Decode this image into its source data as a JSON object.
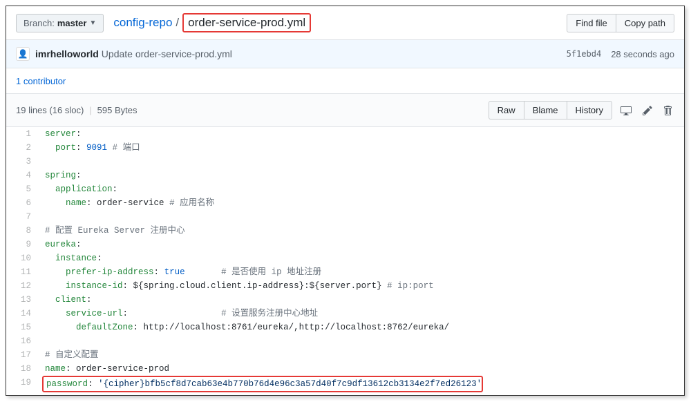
{
  "branch": {
    "label": "Branch:",
    "name": "master"
  },
  "breadcrumb": {
    "repo": "config-repo",
    "sep": "/",
    "file": "order-service-prod.yml"
  },
  "header_buttons": {
    "find": "Find file",
    "copy": "Copy path"
  },
  "commit": {
    "author": "imrhelloworld",
    "message": "Update order-service-prod.yml",
    "sha": "5f1ebd4",
    "time": "28 seconds ago"
  },
  "contributors": "1 contributor",
  "file_info": {
    "lines": "19 lines (16 sloc)",
    "size": "595 Bytes"
  },
  "file_actions": {
    "raw": "Raw",
    "blame": "Blame",
    "history": "History"
  },
  "code": [
    {
      "n": 1,
      "segs": [
        {
          "t": "server",
          "c": "hl-key"
        },
        {
          "t": ":",
          "c": ""
        }
      ]
    },
    {
      "n": 2,
      "segs": [
        {
          "t": "  ",
          "c": ""
        },
        {
          "t": "port",
          "c": "hl-key"
        },
        {
          "t": ": ",
          "c": ""
        },
        {
          "t": "9091",
          "c": "hl-num"
        },
        {
          "t": " ",
          "c": ""
        },
        {
          "t": "# 端口",
          "c": "hl-comment"
        }
      ]
    },
    {
      "n": 3,
      "segs": []
    },
    {
      "n": 4,
      "segs": [
        {
          "t": "spring",
          "c": "hl-key"
        },
        {
          "t": ":",
          "c": ""
        }
      ]
    },
    {
      "n": 5,
      "segs": [
        {
          "t": "  ",
          "c": ""
        },
        {
          "t": "application",
          "c": "hl-key"
        },
        {
          "t": ":",
          "c": ""
        }
      ]
    },
    {
      "n": 6,
      "segs": [
        {
          "t": "    ",
          "c": ""
        },
        {
          "t": "name",
          "c": "hl-key"
        },
        {
          "t": ": order-service ",
          "c": ""
        },
        {
          "t": "# 应用名称",
          "c": "hl-comment"
        }
      ]
    },
    {
      "n": 7,
      "segs": []
    },
    {
      "n": 8,
      "segs": [
        {
          "t": "# 配置 Eureka Server 注册中心",
          "c": "hl-comment"
        }
      ]
    },
    {
      "n": 9,
      "segs": [
        {
          "t": "eureka",
          "c": "hl-key"
        },
        {
          "t": ":",
          "c": ""
        }
      ]
    },
    {
      "n": 10,
      "segs": [
        {
          "t": "  ",
          "c": ""
        },
        {
          "t": "instance",
          "c": "hl-key"
        },
        {
          "t": ":",
          "c": ""
        }
      ]
    },
    {
      "n": 11,
      "segs": [
        {
          "t": "    ",
          "c": ""
        },
        {
          "t": "prefer-ip-address",
          "c": "hl-key"
        },
        {
          "t": ": ",
          "c": ""
        },
        {
          "t": "true",
          "c": "hl-bool"
        },
        {
          "t": "       ",
          "c": ""
        },
        {
          "t": "# 是否使用 ip 地址注册",
          "c": "hl-comment"
        }
      ]
    },
    {
      "n": 12,
      "segs": [
        {
          "t": "    ",
          "c": ""
        },
        {
          "t": "instance-id",
          "c": "hl-key"
        },
        {
          "t": ": ${spring.cloud.client.ip-address}:${server.port} ",
          "c": ""
        },
        {
          "t": "# ip:port",
          "c": "hl-comment"
        }
      ]
    },
    {
      "n": 13,
      "segs": [
        {
          "t": "  ",
          "c": ""
        },
        {
          "t": "client",
          "c": "hl-key"
        },
        {
          "t": ":",
          "c": ""
        }
      ]
    },
    {
      "n": 14,
      "segs": [
        {
          "t": "    ",
          "c": ""
        },
        {
          "t": "service-url",
          "c": "hl-key"
        },
        {
          "t": ":                  ",
          "c": ""
        },
        {
          "t": "# 设置服务注册中心地址",
          "c": "hl-comment"
        }
      ]
    },
    {
      "n": 15,
      "segs": [
        {
          "t": "      ",
          "c": ""
        },
        {
          "t": "defaultZone",
          "c": "hl-key"
        },
        {
          "t": ": http://localhost:8761/eureka/,http://localhost:8762/eureka/",
          "c": ""
        }
      ]
    },
    {
      "n": 16,
      "segs": []
    },
    {
      "n": 17,
      "segs": [
        {
          "t": "# 自定义配置",
          "c": "hl-comment"
        }
      ]
    },
    {
      "n": 18,
      "segs": [
        {
          "t": "name",
          "c": "hl-key"
        },
        {
          "t": ": order-service-prod",
          "c": ""
        }
      ]
    },
    {
      "n": 19,
      "hl": true,
      "segs": [
        {
          "t": "password",
          "c": "hl-key"
        },
        {
          "t": ": ",
          "c": ""
        },
        {
          "t": "'{cipher}bfb5cf8d7cab63e4b770b76d4e96c3a57d40f7c9df13612cb3134e2f7ed26123'",
          "c": "hl-str"
        }
      ]
    }
  ]
}
